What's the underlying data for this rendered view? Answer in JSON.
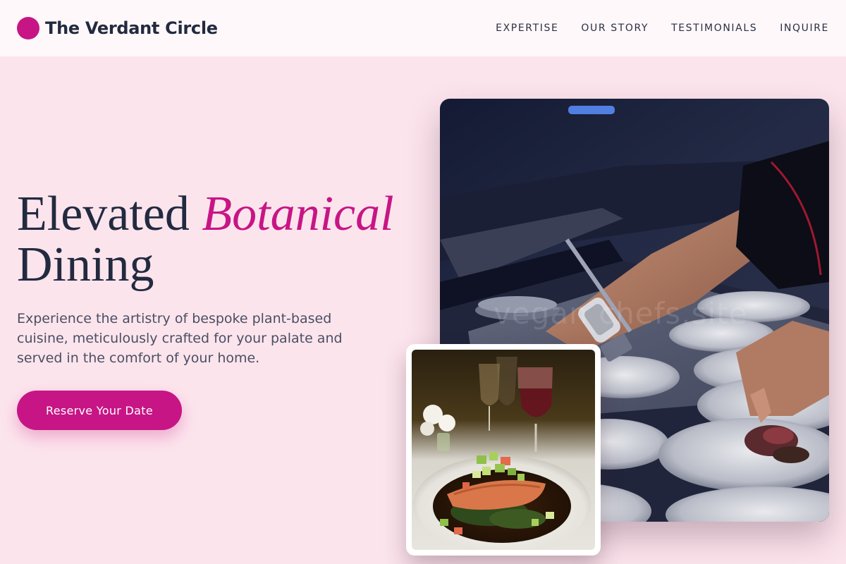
{
  "brand": {
    "name": "The Verdant Circle",
    "accent_color": "#c71585"
  },
  "nav": {
    "items": [
      {
        "label": "EXPERTISE"
      },
      {
        "label": "OUR STORY"
      },
      {
        "label": "TESTIMONIALS"
      },
      {
        "label": "INQUIRE"
      }
    ]
  },
  "hero": {
    "title_part1": "Elevated ",
    "title_accent": "Botanical",
    "title_part2": "Dining",
    "subtitle": "Experience the artistry of bespoke plant-based cuisine, meticulously crafted for your palate and served in the comfort of your home.",
    "cta_label": "Reserve Your Date"
  },
  "images": {
    "main_alt": "chef plating dishes in a professional kitchen",
    "watermark": "vegan chefs.site",
    "inset_alt": "plated fish dish with vegetables and wine glasses"
  },
  "colors": {
    "page_background": "#fce4ec",
    "header_background": "#fff8fa",
    "heading_text": "#222a40",
    "body_text": "#4a4f63"
  }
}
